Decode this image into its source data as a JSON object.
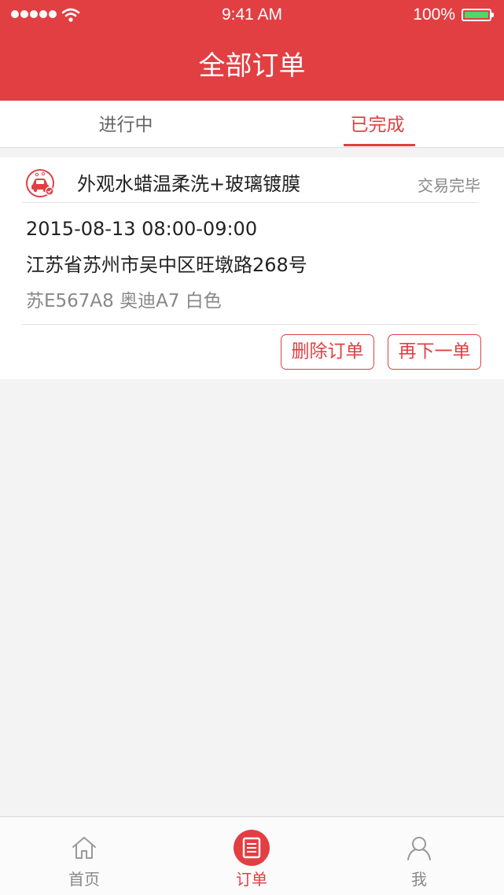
{
  "status_bar": {
    "time": "9:41 AM",
    "battery": "100%",
    "icons": [
      "signal-dots-icon",
      "wifi-icon",
      "battery-icon"
    ]
  },
  "nav": {
    "title": "全部订单"
  },
  "tabs": [
    {
      "label": "进行中",
      "active": false
    },
    {
      "label": "已完成",
      "active": true
    }
  ],
  "order": {
    "icon": "car-wash-icon",
    "service": "外观水蜡温柔洗+玻璃镀膜",
    "status": "交易完毕",
    "time": "2015-08-13 08:00-09:00",
    "address": "江苏省苏州市吴中区旺墩路268号",
    "car": "苏E567A8 奥迪A7 白色",
    "actions": {
      "delete_label": "删除订单",
      "reorder_label": "再下一单"
    }
  },
  "tabbar": [
    {
      "label": "首页",
      "icon": "home-icon",
      "active": false
    },
    {
      "label": "订单",
      "icon": "order-list-icon",
      "active": true
    },
    {
      "label": "我",
      "icon": "user-icon",
      "active": false
    }
  ],
  "colors": {
    "brand": "#e23f43",
    "battery": "#4cd964",
    "muted_text": "#888888",
    "background": "#f3f3f3"
  }
}
